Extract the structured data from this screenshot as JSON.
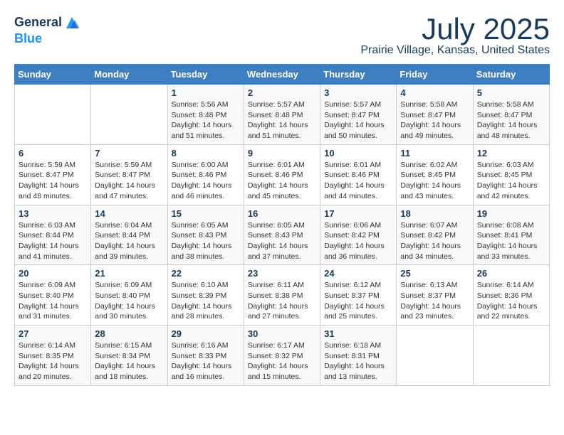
{
  "header": {
    "logo_line1": "General",
    "logo_line2": "Blue",
    "month_title": "July 2025",
    "location": "Prairie Village, Kansas, United States"
  },
  "weekdays": [
    "Sunday",
    "Monday",
    "Tuesday",
    "Wednesday",
    "Thursday",
    "Friday",
    "Saturday"
  ],
  "weeks": [
    [
      {
        "day": "",
        "info": ""
      },
      {
        "day": "",
        "info": ""
      },
      {
        "day": "1",
        "info": "Sunrise: 5:56 AM\nSunset: 8:48 PM\nDaylight: 14 hours and 51 minutes."
      },
      {
        "day": "2",
        "info": "Sunrise: 5:57 AM\nSunset: 8:48 PM\nDaylight: 14 hours and 51 minutes."
      },
      {
        "day": "3",
        "info": "Sunrise: 5:57 AM\nSunset: 8:47 PM\nDaylight: 14 hours and 50 minutes."
      },
      {
        "day": "4",
        "info": "Sunrise: 5:58 AM\nSunset: 8:47 PM\nDaylight: 14 hours and 49 minutes."
      },
      {
        "day": "5",
        "info": "Sunrise: 5:58 AM\nSunset: 8:47 PM\nDaylight: 14 hours and 48 minutes."
      }
    ],
    [
      {
        "day": "6",
        "info": "Sunrise: 5:59 AM\nSunset: 8:47 PM\nDaylight: 14 hours and 48 minutes."
      },
      {
        "day": "7",
        "info": "Sunrise: 5:59 AM\nSunset: 8:47 PM\nDaylight: 14 hours and 47 minutes."
      },
      {
        "day": "8",
        "info": "Sunrise: 6:00 AM\nSunset: 8:46 PM\nDaylight: 14 hours and 46 minutes."
      },
      {
        "day": "9",
        "info": "Sunrise: 6:01 AM\nSunset: 8:46 PM\nDaylight: 14 hours and 45 minutes."
      },
      {
        "day": "10",
        "info": "Sunrise: 6:01 AM\nSunset: 8:46 PM\nDaylight: 14 hours and 44 minutes."
      },
      {
        "day": "11",
        "info": "Sunrise: 6:02 AM\nSunset: 8:45 PM\nDaylight: 14 hours and 43 minutes."
      },
      {
        "day": "12",
        "info": "Sunrise: 6:03 AM\nSunset: 8:45 PM\nDaylight: 14 hours and 42 minutes."
      }
    ],
    [
      {
        "day": "13",
        "info": "Sunrise: 6:03 AM\nSunset: 8:44 PM\nDaylight: 14 hours and 41 minutes."
      },
      {
        "day": "14",
        "info": "Sunrise: 6:04 AM\nSunset: 8:44 PM\nDaylight: 14 hours and 39 minutes."
      },
      {
        "day": "15",
        "info": "Sunrise: 6:05 AM\nSunset: 8:43 PM\nDaylight: 14 hours and 38 minutes."
      },
      {
        "day": "16",
        "info": "Sunrise: 6:05 AM\nSunset: 8:43 PM\nDaylight: 14 hours and 37 minutes."
      },
      {
        "day": "17",
        "info": "Sunrise: 6:06 AM\nSunset: 8:42 PM\nDaylight: 14 hours and 36 minutes."
      },
      {
        "day": "18",
        "info": "Sunrise: 6:07 AM\nSunset: 8:42 PM\nDaylight: 14 hours and 34 minutes."
      },
      {
        "day": "19",
        "info": "Sunrise: 6:08 AM\nSunset: 8:41 PM\nDaylight: 14 hours and 33 minutes."
      }
    ],
    [
      {
        "day": "20",
        "info": "Sunrise: 6:09 AM\nSunset: 8:40 PM\nDaylight: 14 hours and 31 minutes."
      },
      {
        "day": "21",
        "info": "Sunrise: 6:09 AM\nSunset: 8:40 PM\nDaylight: 14 hours and 30 minutes."
      },
      {
        "day": "22",
        "info": "Sunrise: 6:10 AM\nSunset: 8:39 PM\nDaylight: 14 hours and 28 minutes."
      },
      {
        "day": "23",
        "info": "Sunrise: 6:11 AM\nSunset: 8:38 PM\nDaylight: 14 hours and 27 minutes."
      },
      {
        "day": "24",
        "info": "Sunrise: 6:12 AM\nSunset: 8:37 PM\nDaylight: 14 hours and 25 minutes."
      },
      {
        "day": "25",
        "info": "Sunrise: 6:13 AM\nSunset: 8:37 PM\nDaylight: 14 hours and 23 minutes."
      },
      {
        "day": "26",
        "info": "Sunrise: 6:14 AM\nSunset: 8:36 PM\nDaylight: 14 hours and 22 minutes."
      }
    ],
    [
      {
        "day": "27",
        "info": "Sunrise: 6:14 AM\nSunset: 8:35 PM\nDaylight: 14 hours and 20 minutes."
      },
      {
        "day": "28",
        "info": "Sunrise: 6:15 AM\nSunset: 8:34 PM\nDaylight: 14 hours and 18 minutes."
      },
      {
        "day": "29",
        "info": "Sunrise: 6:16 AM\nSunset: 8:33 PM\nDaylight: 14 hours and 16 minutes."
      },
      {
        "day": "30",
        "info": "Sunrise: 6:17 AM\nSunset: 8:32 PM\nDaylight: 14 hours and 15 minutes."
      },
      {
        "day": "31",
        "info": "Sunrise: 6:18 AM\nSunset: 8:31 PM\nDaylight: 14 hours and 13 minutes."
      },
      {
        "day": "",
        "info": ""
      },
      {
        "day": "",
        "info": ""
      }
    ]
  ]
}
